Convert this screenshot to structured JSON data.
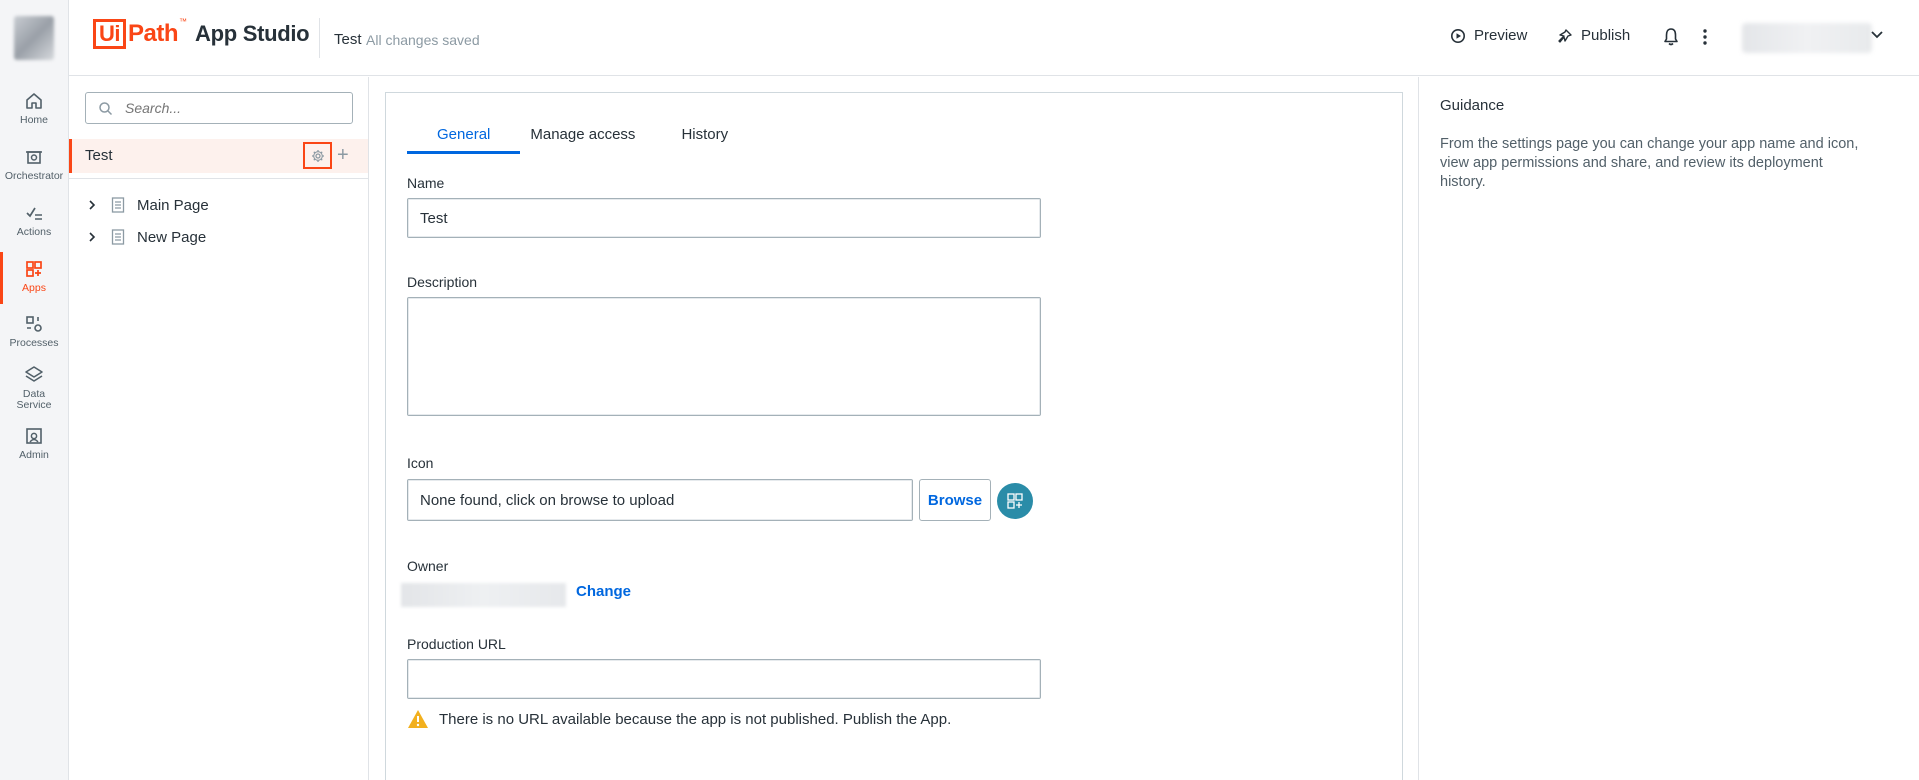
{
  "rail": {
    "items": [
      {
        "label": "Home",
        "icon": "home-icon"
      },
      {
        "label": "Orchestrator",
        "icon": "orchestrator-icon"
      },
      {
        "label": "Actions",
        "icon": "actions-icon"
      },
      {
        "label": "Apps",
        "icon": "apps-icon",
        "active": true
      },
      {
        "label": "Processes",
        "icon": "processes-icon"
      },
      {
        "label": "Data Service",
        "icon": "data-service-icon"
      },
      {
        "label": "Admin",
        "icon": "admin-icon"
      }
    ]
  },
  "header": {
    "logo_ui": "Ui",
    "logo_path": "Path",
    "logo_tm": "™",
    "product": "App Studio",
    "app_name": "Test",
    "save_status": "All changes saved",
    "preview_label": "Preview",
    "publish_label": "Publish"
  },
  "tree": {
    "search_placeholder": "Search...",
    "root_label": "Test",
    "pages": [
      {
        "label": "Main Page"
      },
      {
        "label": "New Page"
      }
    ]
  },
  "settings": {
    "tabs": [
      {
        "label": "General",
        "active": true
      },
      {
        "label": "Manage access"
      },
      {
        "label": "History"
      }
    ],
    "name_label": "Name",
    "name_value": "Test",
    "description_label": "Description",
    "description_value": "",
    "icon_label": "Icon",
    "icon_value": "None found, click on browse to upload",
    "browse_label": "Browse",
    "owner_label": "Owner",
    "change_label": "Change",
    "production_url_label": "Production URL",
    "production_url_value": "",
    "warning_text": "There is no URL available because the app is not published. Publish the App."
  },
  "guidance": {
    "title": "Guidance",
    "body": "From the settings page you can change your app name and icon, view app permissions and share, and review its deployment history."
  },
  "colors": {
    "accent": "#fa4616",
    "link": "#0067df",
    "warning": "#f2b01e",
    "icon_circle": "#2a8ca8"
  }
}
